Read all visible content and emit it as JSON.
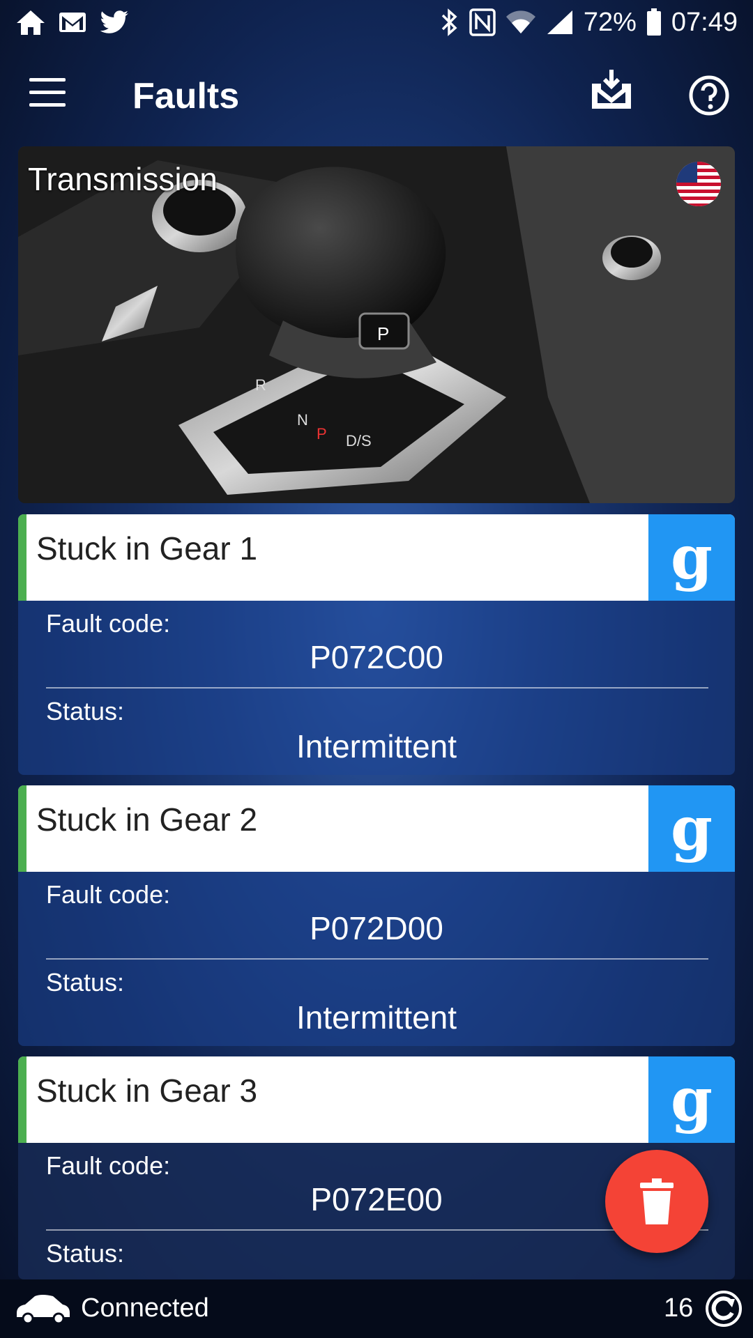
{
  "status_bar": {
    "battery": "72%",
    "time": "07:49",
    "left_icons": [
      "home-icon",
      "gmail-icon",
      "twitter-icon"
    ],
    "right_icons": [
      "bluetooth-icon",
      "nfc-icon",
      "wifi-icon",
      "signal-icon",
      "battery-icon"
    ]
  },
  "app_bar": {
    "title": "Faults",
    "icons": [
      "menu-icon",
      "download-icon",
      "help-icon"
    ]
  },
  "hero": {
    "title": "Transmission",
    "flag_icon": "us-flag-icon"
  },
  "faults": [
    {
      "name": "Stuck in Gear 1",
      "code_label": "Fault code:",
      "code": "P072C00",
      "status_label": "Status:",
      "status": "Intermittent"
    },
    {
      "name": "Stuck in Gear 2",
      "code_label": "Fault code:",
      "code": "P072D00",
      "status_label": "Status:",
      "status": "Intermittent"
    },
    {
      "name": "Stuck in Gear 3",
      "code_label": "Fault code:",
      "code": "P072E00",
      "status_label": "Status:",
      "status": ""
    }
  ],
  "google_button_label": "g",
  "fab_icon": "trash-icon",
  "bottom_bar": {
    "status": "Connected",
    "count": "16"
  },
  "colors": {
    "accent_green": "#4caf50",
    "google_blue": "#2196f3",
    "fab_red": "#f44336"
  }
}
